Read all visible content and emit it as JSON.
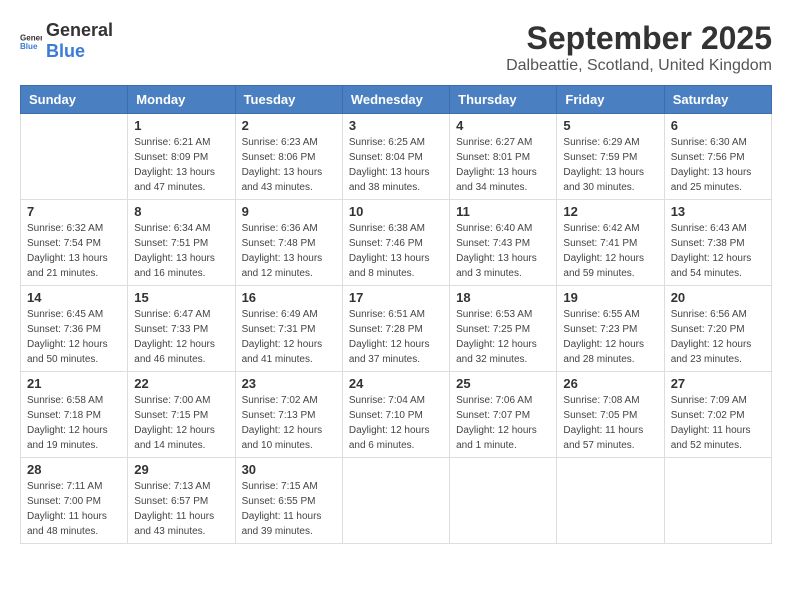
{
  "logo": {
    "text_general": "General",
    "text_blue": "Blue"
  },
  "title": "September 2025",
  "subtitle": "Dalbeattie, Scotland, United Kingdom",
  "weekdays": [
    "Sunday",
    "Monday",
    "Tuesday",
    "Wednesday",
    "Thursday",
    "Friday",
    "Saturday"
  ],
  "weeks": [
    [
      {
        "day": "",
        "sunrise": "",
        "sunset": "",
        "daylight": ""
      },
      {
        "day": "1",
        "sunrise": "Sunrise: 6:21 AM",
        "sunset": "Sunset: 8:09 PM",
        "daylight": "Daylight: 13 hours and 47 minutes."
      },
      {
        "day": "2",
        "sunrise": "Sunrise: 6:23 AM",
        "sunset": "Sunset: 8:06 PM",
        "daylight": "Daylight: 13 hours and 43 minutes."
      },
      {
        "day": "3",
        "sunrise": "Sunrise: 6:25 AM",
        "sunset": "Sunset: 8:04 PM",
        "daylight": "Daylight: 13 hours and 38 minutes."
      },
      {
        "day": "4",
        "sunrise": "Sunrise: 6:27 AM",
        "sunset": "Sunset: 8:01 PM",
        "daylight": "Daylight: 13 hours and 34 minutes."
      },
      {
        "day": "5",
        "sunrise": "Sunrise: 6:29 AM",
        "sunset": "Sunset: 7:59 PM",
        "daylight": "Daylight: 13 hours and 30 minutes."
      },
      {
        "day": "6",
        "sunrise": "Sunrise: 6:30 AM",
        "sunset": "Sunset: 7:56 PM",
        "daylight": "Daylight: 13 hours and 25 minutes."
      }
    ],
    [
      {
        "day": "7",
        "sunrise": "Sunrise: 6:32 AM",
        "sunset": "Sunset: 7:54 PM",
        "daylight": "Daylight: 13 hours and 21 minutes."
      },
      {
        "day": "8",
        "sunrise": "Sunrise: 6:34 AM",
        "sunset": "Sunset: 7:51 PM",
        "daylight": "Daylight: 13 hours and 16 minutes."
      },
      {
        "day": "9",
        "sunrise": "Sunrise: 6:36 AM",
        "sunset": "Sunset: 7:48 PM",
        "daylight": "Daylight: 13 hours and 12 minutes."
      },
      {
        "day": "10",
        "sunrise": "Sunrise: 6:38 AM",
        "sunset": "Sunset: 7:46 PM",
        "daylight": "Daylight: 13 hours and 8 minutes."
      },
      {
        "day": "11",
        "sunrise": "Sunrise: 6:40 AM",
        "sunset": "Sunset: 7:43 PM",
        "daylight": "Daylight: 13 hours and 3 minutes."
      },
      {
        "day": "12",
        "sunrise": "Sunrise: 6:42 AM",
        "sunset": "Sunset: 7:41 PM",
        "daylight": "Daylight: 12 hours and 59 minutes."
      },
      {
        "day": "13",
        "sunrise": "Sunrise: 6:43 AM",
        "sunset": "Sunset: 7:38 PM",
        "daylight": "Daylight: 12 hours and 54 minutes."
      }
    ],
    [
      {
        "day": "14",
        "sunrise": "Sunrise: 6:45 AM",
        "sunset": "Sunset: 7:36 PM",
        "daylight": "Daylight: 12 hours and 50 minutes."
      },
      {
        "day": "15",
        "sunrise": "Sunrise: 6:47 AM",
        "sunset": "Sunset: 7:33 PM",
        "daylight": "Daylight: 12 hours and 46 minutes."
      },
      {
        "day": "16",
        "sunrise": "Sunrise: 6:49 AM",
        "sunset": "Sunset: 7:31 PM",
        "daylight": "Daylight: 12 hours and 41 minutes."
      },
      {
        "day": "17",
        "sunrise": "Sunrise: 6:51 AM",
        "sunset": "Sunset: 7:28 PM",
        "daylight": "Daylight: 12 hours and 37 minutes."
      },
      {
        "day": "18",
        "sunrise": "Sunrise: 6:53 AM",
        "sunset": "Sunset: 7:25 PM",
        "daylight": "Daylight: 12 hours and 32 minutes."
      },
      {
        "day": "19",
        "sunrise": "Sunrise: 6:55 AM",
        "sunset": "Sunset: 7:23 PM",
        "daylight": "Daylight: 12 hours and 28 minutes."
      },
      {
        "day": "20",
        "sunrise": "Sunrise: 6:56 AM",
        "sunset": "Sunset: 7:20 PM",
        "daylight": "Daylight: 12 hours and 23 minutes."
      }
    ],
    [
      {
        "day": "21",
        "sunrise": "Sunrise: 6:58 AM",
        "sunset": "Sunset: 7:18 PM",
        "daylight": "Daylight: 12 hours and 19 minutes."
      },
      {
        "day": "22",
        "sunrise": "Sunrise: 7:00 AM",
        "sunset": "Sunset: 7:15 PM",
        "daylight": "Daylight: 12 hours and 14 minutes."
      },
      {
        "day": "23",
        "sunrise": "Sunrise: 7:02 AM",
        "sunset": "Sunset: 7:13 PM",
        "daylight": "Daylight: 12 hours and 10 minutes."
      },
      {
        "day": "24",
        "sunrise": "Sunrise: 7:04 AM",
        "sunset": "Sunset: 7:10 PM",
        "daylight": "Daylight: 12 hours and 6 minutes."
      },
      {
        "day": "25",
        "sunrise": "Sunrise: 7:06 AM",
        "sunset": "Sunset: 7:07 PM",
        "daylight": "Daylight: 12 hours and 1 minute."
      },
      {
        "day": "26",
        "sunrise": "Sunrise: 7:08 AM",
        "sunset": "Sunset: 7:05 PM",
        "daylight": "Daylight: 11 hours and 57 minutes."
      },
      {
        "day": "27",
        "sunrise": "Sunrise: 7:09 AM",
        "sunset": "Sunset: 7:02 PM",
        "daylight": "Daylight: 11 hours and 52 minutes."
      }
    ],
    [
      {
        "day": "28",
        "sunrise": "Sunrise: 7:11 AM",
        "sunset": "Sunset: 7:00 PM",
        "daylight": "Daylight: 11 hours and 48 minutes."
      },
      {
        "day": "29",
        "sunrise": "Sunrise: 7:13 AM",
        "sunset": "Sunset: 6:57 PM",
        "daylight": "Daylight: 11 hours and 43 minutes."
      },
      {
        "day": "30",
        "sunrise": "Sunrise: 7:15 AM",
        "sunset": "Sunset: 6:55 PM",
        "daylight": "Daylight: 11 hours and 39 minutes."
      },
      {
        "day": "",
        "sunrise": "",
        "sunset": "",
        "daylight": ""
      },
      {
        "day": "",
        "sunrise": "",
        "sunset": "",
        "daylight": ""
      },
      {
        "day": "",
        "sunrise": "",
        "sunset": "",
        "daylight": ""
      },
      {
        "day": "",
        "sunrise": "",
        "sunset": "",
        "daylight": ""
      }
    ]
  ]
}
